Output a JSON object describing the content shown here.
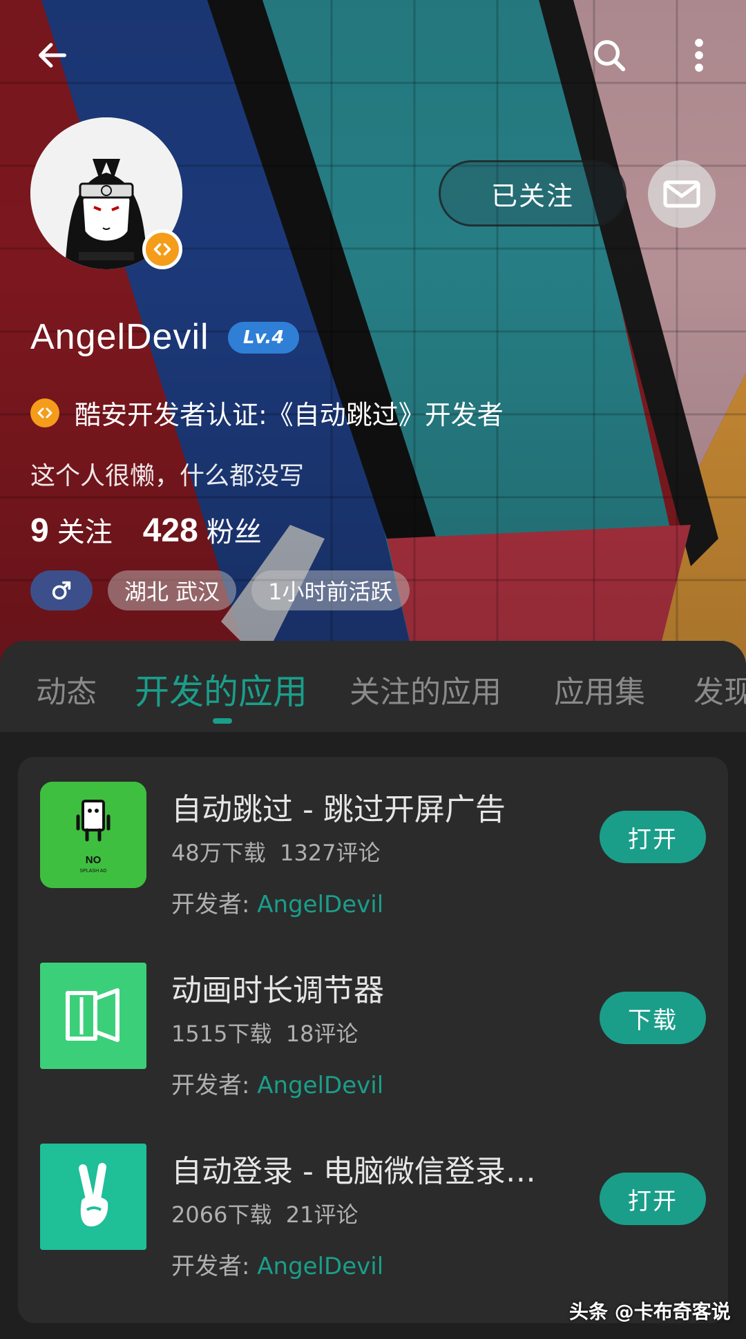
{
  "profile": {
    "username": "AngelDevil",
    "level": "Lv.4",
    "cert_text": "酷安开发者认证:《自动跳过》开发者",
    "bio": "这个人很懒，什么都没写",
    "following_count": "9",
    "following_label": "关注",
    "followers_count": "428",
    "followers_label": "粉丝",
    "tags": [
      "湖北 武汉",
      "1小时前活跃"
    ],
    "follow_button": "已关注"
  },
  "icons": {
    "back": "arrow-left-icon",
    "search": "search-icon",
    "more": "more-vertical-icon",
    "message": "mail-icon",
    "gender": "male-icon",
    "developer_badge": "code-brackets-icon"
  },
  "tabs": [
    "动态",
    "开发的应用",
    "关注的应用",
    "应用集",
    "发现"
  ],
  "active_tab": "开发的应用",
  "apps": [
    {
      "name": "自动跳过 - 跳过开屏广告",
      "downloads": "48万下载",
      "comments": "1327评论",
      "developer_label": "开发者:",
      "developer": "AngelDevil",
      "button": "打开",
      "icon_text": "NO",
      "icon_subtext": "SPLASH AD"
    },
    {
      "name": "动画时长调节器",
      "downloads": "1515下载",
      "comments": "18评论",
      "developer_label": "开发者:",
      "developer": "AngelDevil",
      "button": "下载"
    },
    {
      "name": "自动登录 - 电脑微信登录…",
      "downloads": "2066下载",
      "comments": "21评论",
      "developer_label": "开发者:",
      "developer": "AngelDevil",
      "button": "打开"
    }
  ],
  "watermark": "头条 @卡布奇客说",
  "colors": {
    "accent": "#1a9e8a",
    "level_badge": "#2f7fd6",
    "dev_badge": "#f59c1a",
    "card_bg": "#2b2b2b",
    "page_bg": "#1f1f1f"
  }
}
